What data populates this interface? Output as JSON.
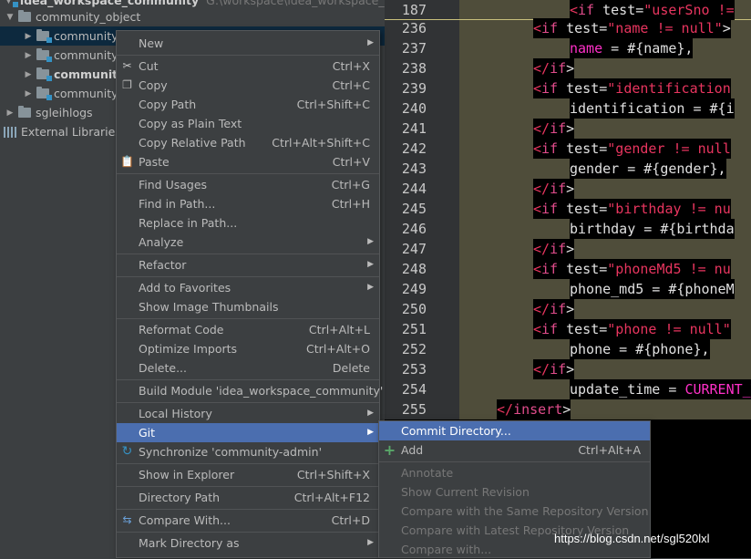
{
  "tree": {
    "top_label": "idea_workspace_community",
    "top_path": "G:\\workspace\\idea_workspace_community",
    "items": [
      {
        "label": "community_object",
        "bold": false
      },
      {
        "label": "community-",
        "bold": false
      },
      {
        "label": "community-",
        "bold": false
      },
      {
        "label": "community",
        "bold": true
      },
      {
        "label": "community-",
        "bold": false
      },
      {
        "label": "sgleihlogs",
        "bold": false
      },
      {
        "label": "External Libraries",
        "bold": false
      }
    ]
  },
  "editor": {
    "top_line_number": "187",
    "top_line_code": "<if test=\"userSno !=",
    "lines": [
      {
        "n": "236",
        "segs": [
          [
            "tg",
            "<"
          ],
          [
            "kw",
            "if"
          ],
          [
            "t",
            " test="
          ],
          [
            "str",
            "\"name != null\""
          ],
          [
            "t",
            ">"
          ]
        ]
      },
      {
        "n": "237",
        "segs": [
          [
            "fn",
            "name"
          ],
          [
            "t",
            " = #{name},"
          ]
        ]
      },
      {
        "n": "238",
        "segs": [
          [
            "tg",
            "</"
          ],
          [
            "kw",
            "if"
          ],
          [
            "t",
            ">"
          ]
        ]
      },
      {
        "n": "239",
        "segs": [
          [
            "tg",
            "<"
          ],
          [
            "kw",
            "if"
          ],
          [
            "t",
            " test="
          ],
          [
            "str",
            "\"identification"
          ]
        ]
      },
      {
        "n": "240",
        "segs": [
          [
            "t",
            "identification = #{i"
          ]
        ]
      },
      {
        "n": "241",
        "segs": [
          [
            "tg",
            "</"
          ],
          [
            "kw",
            "if"
          ],
          [
            "t",
            ">"
          ]
        ]
      },
      {
        "n": "242",
        "segs": [
          [
            "tg",
            "<"
          ],
          [
            "kw",
            "if"
          ],
          [
            "t",
            " test="
          ],
          [
            "str",
            "\"gender != null"
          ]
        ]
      },
      {
        "n": "243",
        "segs": [
          [
            "t",
            "gender = #{gender},"
          ]
        ]
      },
      {
        "n": "244",
        "segs": [
          [
            "tg",
            "</"
          ],
          [
            "kw",
            "if"
          ],
          [
            "t",
            ">"
          ]
        ]
      },
      {
        "n": "245",
        "segs": [
          [
            "tg",
            "<"
          ],
          [
            "kw",
            "if"
          ],
          [
            "t",
            " test="
          ],
          [
            "str",
            "\"birthday != nu"
          ]
        ]
      },
      {
        "n": "246",
        "segs": [
          [
            "t",
            "birthday = #{birthda"
          ]
        ]
      },
      {
        "n": "247",
        "segs": [
          [
            "tg",
            "</"
          ],
          [
            "kw",
            "if"
          ],
          [
            "t",
            ">"
          ]
        ]
      },
      {
        "n": "248",
        "segs": [
          [
            "tg",
            "<"
          ],
          [
            "kw",
            "if"
          ],
          [
            "t",
            " test="
          ],
          [
            "str",
            "\"phoneMd5 != nu"
          ]
        ]
      },
      {
        "n": "249",
        "segs": [
          [
            "t",
            "phone_md5 = #{phoneM"
          ]
        ]
      },
      {
        "n": "250",
        "segs": [
          [
            "tg",
            "</"
          ],
          [
            "kw",
            "if"
          ],
          [
            "t",
            ">"
          ]
        ]
      },
      {
        "n": "251",
        "segs": [
          [
            "tg",
            "<"
          ],
          [
            "kw",
            "if"
          ],
          [
            "t",
            " test="
          ],
          [
            "str",
            "\"phone != null\""
          ]
        ]
      },
      {
        "n": "252",
        "segs": [
          [
            "t",
            "phone = #{phone},"
          ]
        ]
      },
      {
        "n": "253",
        "segs": [
          [
            "tg",
            "</"
          ],
          [
            "kw",
            "if"
          ],
          [
            "t",
            ">"
          ]
        ]
      },
      {
        "n": "254",
        "segs": [
          [
            "t",
            "update_time = "
          ],
          [
            "fn",
            "CURRENT_TI"
          ]
        ]
      },
      {
        "n": "255",
        "segs": [
          [
            "tg",
            "</"
          ],
          [
            "kw",
            "insert"
          ],
          [
            "t",
            ">"
          ]
        ]
      }
    ]
  },
  "context_menu": {
    "items": [
      {
        "label": "New",
        "shortcut": "",
        "submenu": true,
        "icon": ""
      },
      {
        "sep": true
      },
      {
        "label": "Cut",
        "shortcut": "Ctrl+X",
        "icon": "scissors-icon",
        "glyph": "✂"
      },
      {
        "label": "Copy",
        "shortcut": "Ctrl+C",
        "icon": "copy-icon",
        "glyph": "❐"
      },
      {
        "label": "Copy Path",
        "shortcut": "Ctrl+Shift+C"
      },
      {
        "label": "Copy as Plain Text",
        "shortcut": ""
      },
      {
        "label": "Copy Relative Path",
        "shortcut": "Ctrl+Alt+Shift+C"
      },
      {
        "label": "Paste",
        "shortcut": "Ctrl+V",
        "icon": "paste-icon",
        "glyph": "📋"
      },
      {
        "sep": true
      },
      {
        "label": "Find Usages",
        "shortcut": "Ctrl+G"
      },
      {
        "label": "Find in Path...",
        "shortcut": "Ctrl+H"
      },
      {
        "label": "Replace in Path...",
        "shortcut": ""
      },
      {
        "label": "Analyze",
        "shortcut": "",
        "submenu": true
      },
      {
        "sep": true
      },
      {
        "label": "Refactor",
        "shortcut": "",
        "submenu": true
      },
      {
        "sep": true
      },
      {
        "label": "Add to Favorites",
        "shortcut": "",
        "submenu": true
      },
      {
        "label": "Show Image Thumbnails",
        "shortcut": ""
      },
      {
        "sep": true
      },
      {
        "label": "Reformat Code",
        "shortcut": "Ctrl+Alt+L"
      },
      {
        "label": "Optimize Imports",
        "shortcut": "Ctrl+Alt+O"
      },
      {
        "label": "Delete...",
        "shortcut": "Delete"
      },
      {
        "sep": true
      },
      {
        "label": "Build Module 'idea_workspace_community'",
        "shortcut": ""
      },
      {
        "sep": true
      },
      {
        "label": "Local History",
        "shortcut": "",
        "submenu": true
      },
      {
        "label": "Git",
        "shortcut": "",
        "submenu": true,
        "highlight": true
      },
      {
        "label": "Synchronize 'community-admin'",
        "shortcut": "",
        "icon": "sync-icon",
        "glyph": "↻"
      },
      {
        "sep": true
      },
      {
        "label": "Show in Explorer",
        "shortcut": "Ctrl+Shift+X"
      },
      {
        "sep": true
      },
      {
        "label": "Directory Path",
        "shortcut": "Ctrl+Alt+F12"
      },
      {
        "sep": true
      },
      {
        "label": "Compare With...",
        "shortcut": "Ctrl+D",
        "icon": "compare-icon",
        "glyph": "⇆"
      },
      {
        "sep": true
      },
      {
        "label": "Mark Directory as",
        "shortcut": "",
        "submenu": true
      }
    ]
  },
  "git_menu": {
    "items": [
      {
        "label": "Commit Directory...",
        "shortcut": "",
        "highlight": true
      },
      {
        "label": "Add",
        "shortcut": "Ctrl+Alt+A",
        "icon": "plus-icon",
        "glyph": "+"
      },
      {
        "sep": true
      },
      {
        "label": "Annotate",
        "shortcut": "",
        "disabled": true
      },
      {
        "label": "Show Current Revision",
        "shortcut": "",
        "disabled": true
      },
      {
        "label": "Compare with the Same Repository Version",
        "shortcut": "",
        "disabled": true
      },
      {
        "label": "Compare with Latest Repository Version",
        "shortcut": "",
        "disabled": true
      },
      {
        "label": "Compare with...",
        "shortcut": "",
        "disabled": true
      }
    ]
  },
  "watermark": "https://blog.csdn.net/sgl520lxl",
  "colors": {
    "highlight": "#4b6eaf",
    "menu_bg": "#3c3f41",
    "editor_bg": "#000000"
  }
}
